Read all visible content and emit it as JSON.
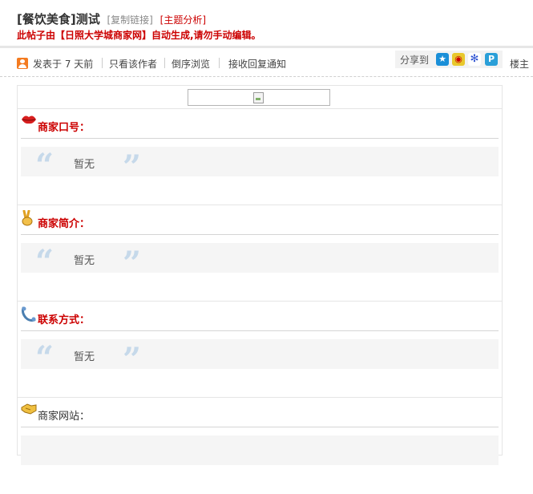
{
  "header": {
    "title": "[餐饮美食]测试",
    "copy_link": "[复制链接]",
    "analysis": "[主题分析]",
    "notice": "此帖子由【日照大学城商家网】自动生成,请勿手动编辑。"
  },
  "toolbar": {
    "posted": "发表于 7 天前",
    "author_only": "只看该作者",
    "reverse": "倒序浏览",
    "notify": "接收回复通知",
    "share_label": "分享到",
    "floor": "楼主"
  },
  "sections": [
    {
      "icon": "lips-icon",
      "label": "商家口号：",
      "content": "暂无"
    },
    {
      "icon": "victory-hand-icon",
      "label": "商家简介：",
      "content": "暂无"
    },
    {
      "icon": "phone-icon",
      "label": "联系方式：",
      "content": "暂无"
    },
    {
      "icon": "handshake-icon",
      "label": "商家网站："
    }
  ],
  "colors": {
    "accent_red": "#cc0000",
    "quote_blue": "#c6d9ea"
  }
}
